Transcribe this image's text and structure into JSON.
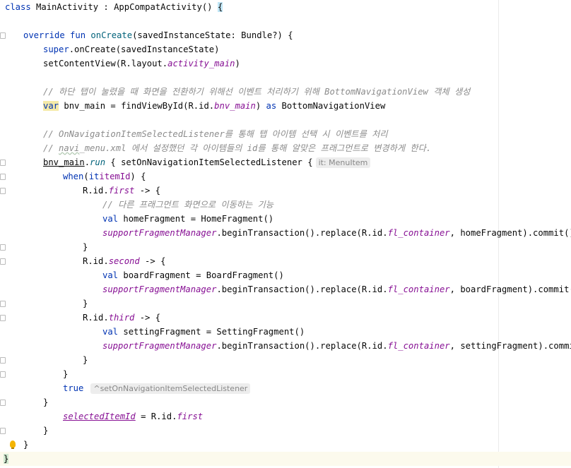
{
  "editor": {
    "language": "kotlin",
    "hints": {
      "it_type": "it: MenuItem",
      "lambda_return": "^setOnNavigationItemSelectedListener"
    },
    "lines": {
      "l1": {
        "a": "class ",
        "b": "MainActivity : AppCompatActivity() ",
        "c": "{"
      },
      "l3": {
        "a": "override fun ",
        "b": "onCreate",
        "c": "(savedInstanceState: Bundle?) {"
      },
      "l4": {
        "a": "super",
        "b": ".onCreate(savedInstanceState)"
      },
      "l5": {
        "a": "setContentView(R.layout.",
        "b": "activity_main",
        "c": ")"
      },
      "l7": {
        "a": "// 하단 탭이 눌렸을 때 화면을 전환하기 위해선 이벤트 처리하기 위해 BottomNavigationView 객체 생성"
      },
      "l8": {
        "a": "var",
        "b": " bnv_main = findViewById(R.id.",
        "c": "bnv_main",
        "d": ") ",
        "e": "as",
        " f": "",
        "g": " BottomNavigationView"
      },
      "l10": {
        "a": "// OnNavigationItemSelectedListener를 통해 탭 아이템 선택 시 이벤트를 처리"
      },
      "l11a": "// ",
      "l11b": "navi",
      "l11c": "_menu.xml 에서 설정했던 각 아이템들의 id를 통해 알맞은 프래그먼트로 변경하게 한다.",
      "l12": {
        "a": "bnv_main",
        "b": ".",
        "c": "run",
        "d": " { setOnNavigationItemSelectedListener {"
      },
      "l13": {
        "a": "when",
        "b": "(",
        "c": "it",
        ".": ".",
        "d": "itemId",
        "e": ") {"
      },
      "l14": {
        "a": "R.id.",
        "b": "first",
        "c": " -> {"
      },
      "l15": {
        "a": "// 다른 프래그먼트 화면으로 이동하는 기능"
      },
      "l16": {
        "a": "val",
        "b": " homeFragment = HomeFragment()"
      },
      "l17": {
        "a": "supportFragmentManager",
        "b": ".beginTransaction().replace(R.id.",
        "c": "fl_container",
        "d": ", homeFragment).commit()"
      },
      "l18": {
        "a": "}"
      },
      "l19": {
        "a": "R.id.",
        "b": "second",
        "c": " -> {"
      },
      "l20": {
        "a": "val",
        "b": " boardFragment = BoardFragment()"
      },
      "l21": {
        "a": "supportFragmentManager",
        "b": ".beginTransaction().replace(R.id.",
        "c": "fl_container",
        "d": ", boardFragment).commit()"
      },
      "l22": {
        "a": "}"
      },
      "l23": {
        "a": "R.id.",
        "b": "third",
        "c": " -> {"
      },
      "l24": {
        "a": "val",
        "b": " settingFragment = SettingFragment()"
      },
      "l25": {
        "a": "supportFragmentManager",
        "b": ".beginTransaction().replace(R.id.",
        "c": "fl_container",
        "d": ", settingFragment).commit()"
      },
      "l26": {
        "a": "}"
      },
      "l27": {
        "a": "}"
      },
      "l28": {
        "a": "true"
      },
      "l29": {
        "a": "}"
      },
      "l31": {
        "a": "selectedItemId",
        "b": " = R.id.",
        "c": "first"
      },
      "l32": {
        "a": "}"
      },
      "l33": {
        "a": "}"
      },
      "l34": {
        "a": "}"
      }
    }
  }
}
